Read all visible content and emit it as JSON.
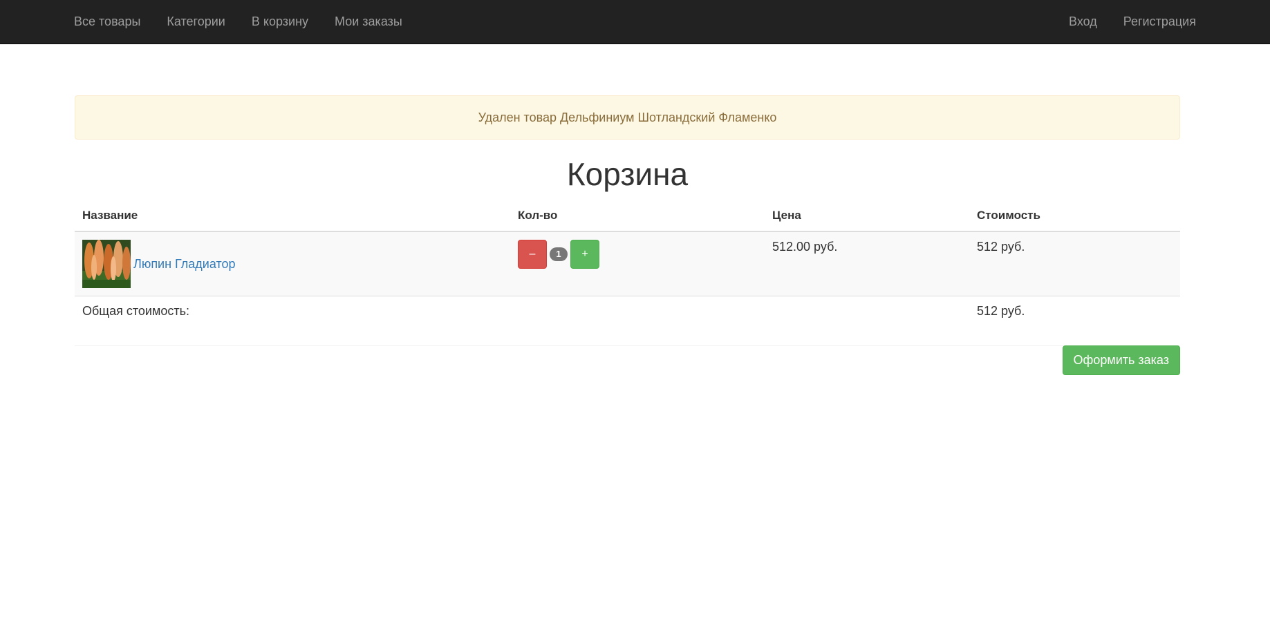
{
  "navbar": {
    "left_items": [
      "Все товары",
      "Категории",
      "В корзину",
      "Мои заказы"
    ],
    "right_items": [
      "Вход",
      "Регистрация"
    ]
  },
  "alert": {
    "text": "Удален товар Дельфиниум Шотландский Фламенко",
    "type": "warning"
  },
  "page_title": "Корзина",
  "table": {
    "headers": {
      "name": "Название",
      "qty": "Кол-во",
      "price": "Цена",
      "cost": "Стоимость"
    },
    "rows": [
      {
        "image_alt": "Lupine flowers thumbnail",
        "name": "Люпин Гладиатор",
        "minus_label": "–",
        "qty": "1",
        "plus_label": "+",
        "price": "512.00 руб.",
        "cost": "512 руб."
      }
    ],
    "total_label": "Общая стоимость:",
    "total_value": "512 руб."
  },
  "order_button": "Оформить заказ",
  "colors": {
    "navbar_bg": "#222222",
    "navbar_link": "#9d9d9d",
    "alert_bg": "#fcf8e3",
    "alert_text": "#8a6d3b",
    "link": "#337ab7",
    "danger": "#d9534f",
    "success": "#5cb85c",
    "badge": "#777777"
  }
}
